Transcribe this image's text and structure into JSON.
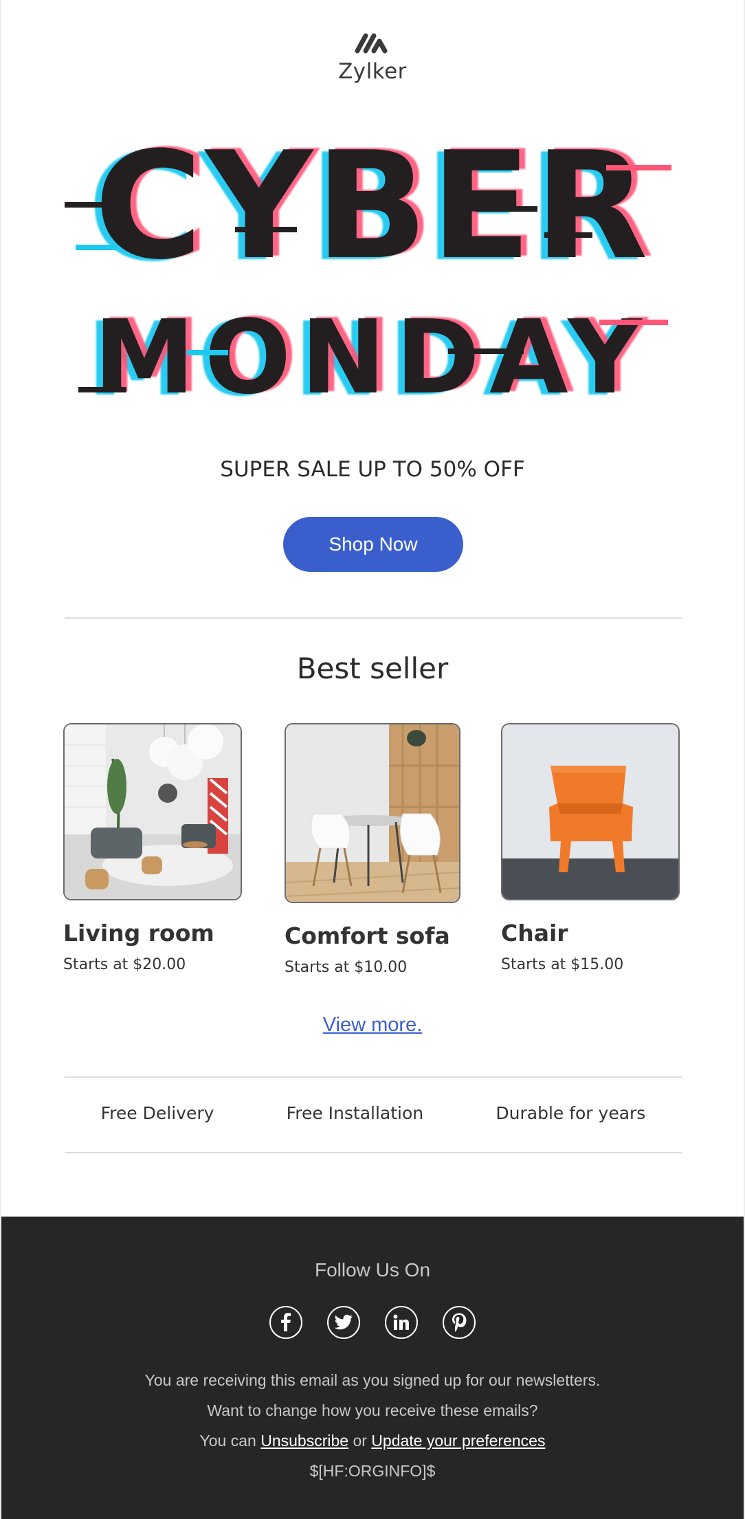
{
  "brand": {
    "name": "Zylker",
    "logo_icon": "zylker-logo-icon"
  },
  "hero": {
    "line1": "CYBER",
    "line2": "MONDAY",
    "colors": {
      "main": "#231f20",
      "cyan": "#1ec9f0",
      "pink": "#ff5577"
    }
  },
  "sale_text": "SUPER SALE UP TO 50% OFF",
  "cta": {
    "label": "Shop Now",
    "color": "#3a5fcd"
  },
  "best_seller": {
    "title": "Best seller",
    "products": [
      {
        "name": "Living room",
        "price": "Starts at $20.00"
      },
      {
        "name": "Comfort sofa",
        "price": "Starts at $10.00"
      },
      {
        "name": "Chair",
        "price": "Starts at $15.00"
      }
    ],
    "view_more": "View more."
  },
  "features": [
    "Free Delivery",
    "Free Installation",
    "Durable for years"
  ],
  "footer": {
    "follow_title": "Follow Us On",
    "social_icons": [
      "facebook-icon",
      "twitter-icon",
      "linkedin-icon",
      "pinterest-icon"
    ],
    "line1": "You are receiving this email as you signed up for our newsletters.",
    "line2": "Want to change how you receive these emails?",
    "line3_prefix": "You can",
    "unsubscribe": "Unsubscribe",
    "line3_or": "or",
    "update_prefs": "Update your preferences",
    "orginfo": "$[HF:ORGINFO]$",
    "background": "#262626"
  }
}
